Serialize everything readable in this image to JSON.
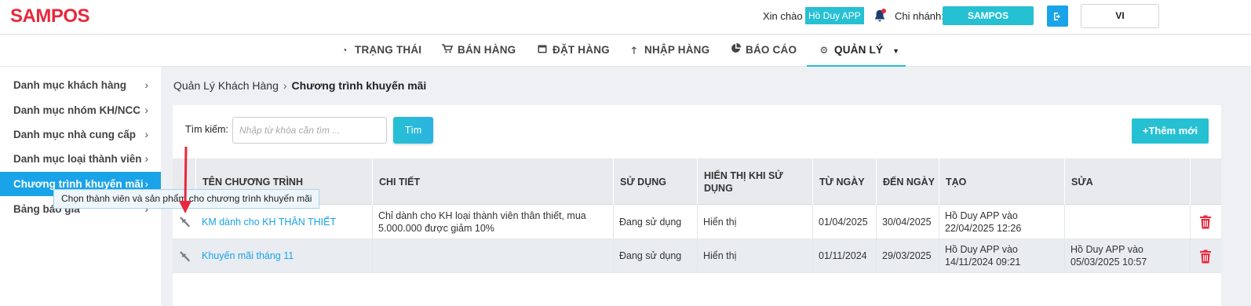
{
  "header": {
    "logo": "SAMPOS",
    "greeting": "Xin chào",
    "user_name": "Hồ Duy APP",
    "bell_icon": "bell-icon",
    "branch_label": "Chi nhánh:",
    "branch_name": "SAMPOS",
    "logout_icon": "logout-icon",
    "language": "VI"
  },
  "nav": {
    "items": [
      {
        "label": "TRẠNG THÁI",
        "icon": "dashboard-icon"
      },
      {
        "label": "BÁN HÀNG",
        "icon": "cart-icon"
      },
      {
        "label": "ĐẶT HÀNG",
        "icon": "calendar-icon"
      },
      {
        "label": "NHẬP HÀNG",
        "icon": "arrow-up-icon"
      },
      {
        "label": "BÁO CÁO",
        "icon": "pie-chart-icon"
      },
      {
        "label": "QUẢN LÝ",
        "icon": "gear-icon"
      }
    ],
    "active": "QUẢN LÝ"
  },
  "sidebar": {
    "items": [
      {
        "label": "Danh mục khách hàng"
      },
      {
        "label": "Danh mục nhóm KH/NCC"
      },
      {
        "label": "Danh mục nhà cung cấp"
      },
      {
        "label": "Danh mục loại thành viên"
      },
      {
        "label": "Chương trình khuyến mãi"
      },
      {
        "label": "Bảng báo giá"
      }
    ],
    "active": "Chương trình khuyến mãi"
  },
  "breadcrumb": {
    "parent": "Quản Lý Khách Hàng",
    "current": "Chương trình khuyến mãi"
  },
  "toolbar": {
    "search_label": "Tìm kiếm:",
    "search_placeholder": "Nhập từ khóa cần tìm ...",
    "search_value": "",
    "search_button": "Tìm",
    "add_button": "Thêm mới"
  },
  "table": {
    "columns": [
      "TÊN CHƯƠNG TRÌNH",
      "CHI TIẾT",
      "SỬ DỤNG",
      "HIỂN THỊ KHI SỬ DỤNG",
      "TỪ NGÀY",
      "ĐẾN NGÀY",
      "TẠO",
      "SỬA"
    ],
    "rows": [
      {
        "name": "KM dành cho KH THÂN THIẾT",
        "detail": "Chỉ dành cho KH loại thành viên thân thiết, mua 5.000.000 được giảm 10%",
        "usage": "Đang sử dụng",
        "display": "Hiển thị",
        "from": "01/04/2025",
        "to": "30/04/2025",
        "created": "Hồ Duy APP vào 22/04/2025 12:26",
        "edited": ""
      },
      {
        "name": "Khuyến mãi tháng 11",
        "detail": "",
        "usage": "Đang sử dụng",
        "display": "Hiển thị",
        "from": "01/11/2024",
        "to": "29/03/2025",
        "created": "Hồ Duy APP vào 14/11/2024 09:21",
        "edited": "Hồ Duy APP vào 05/03/2025 10:57"
      }
    ]
  },
  "tooltip": {
    "text": "Chọn thành viên và sản phẩm cho chương trình khuyến mãi"
  },
  "colors": {
    "brand": "#e8283c",
    "accent": "#26c0d3",
    "active_blue": "#1aa3e8",
    "delete": "#e8283c"
  }
}
